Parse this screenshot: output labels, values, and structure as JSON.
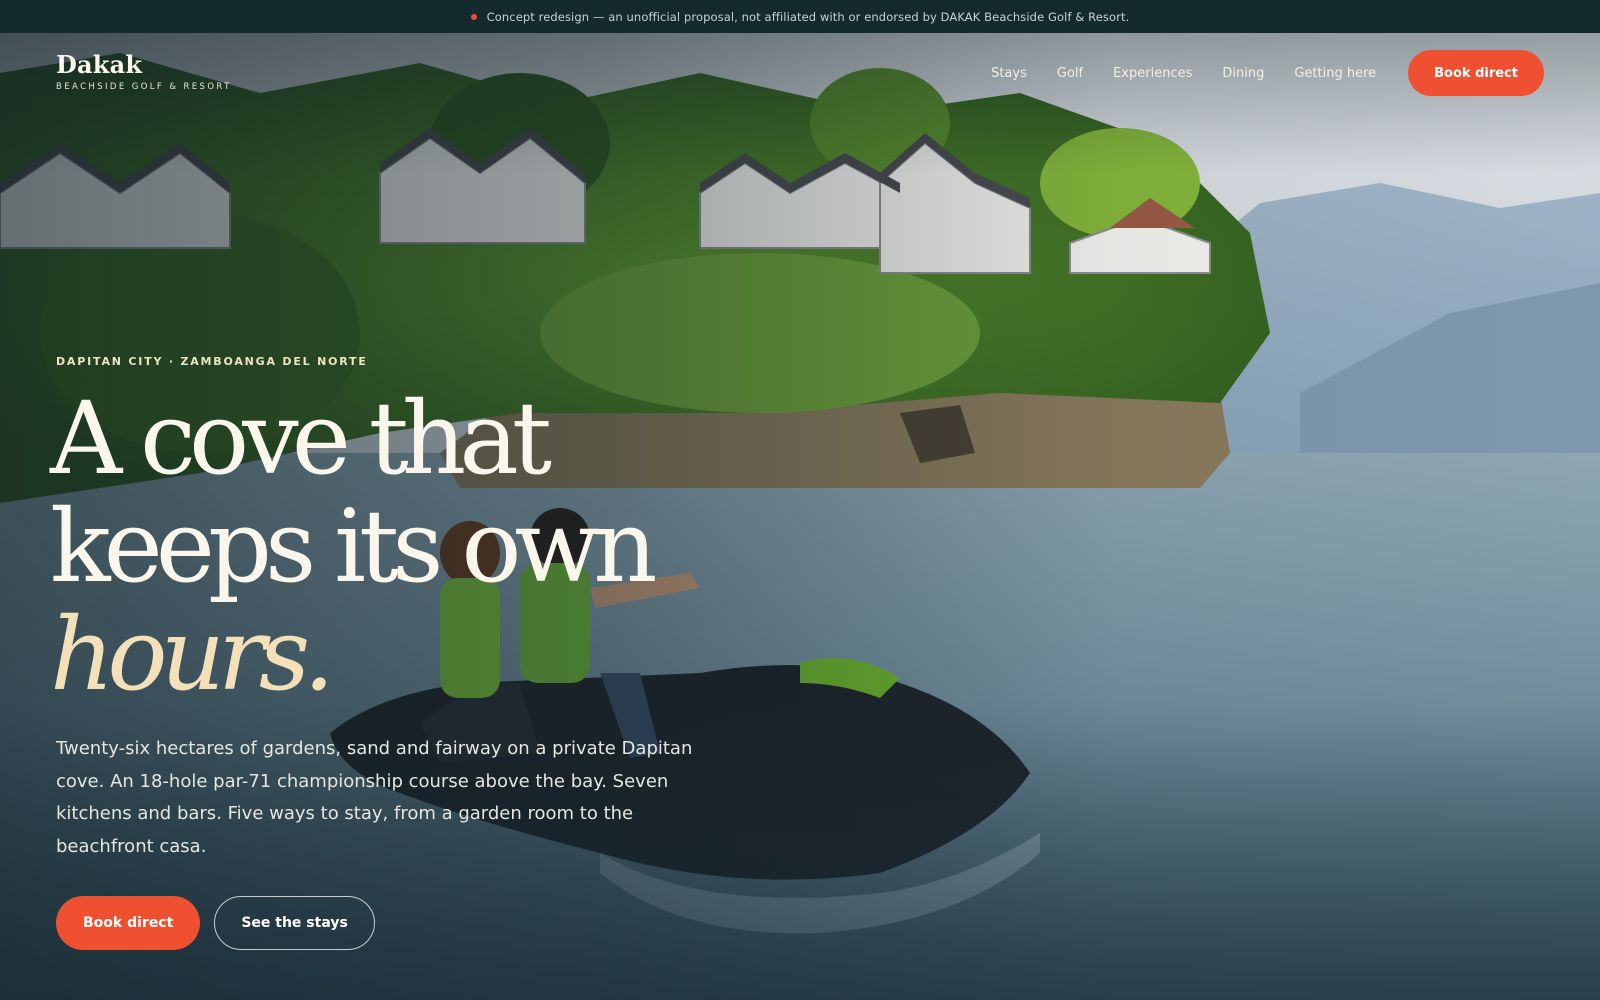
{
  "banner": {
    "text": "Concept redesign — an unofficial proposal, not affiliated with or endorsed by DAKAK Beachside Golf & Resort.",
    "dot_color": "#f05032"
  },
  "brand": {
    "name": "Dakak",
    "tagline": "BEACHSIDE GOLF & RESORT"
  },
  "nav": {
    "items": [
      "Stays",
      "Golf",
      "Experiences",
      "Dining",
      "Getting here"
    ],
    "book_label": "Book direct"
  },
  "hero": {
    "eyebrow": "DAPITAN CITY · ZAMBOANGA DEL NORTE",
    "headline": {
      "line1": "A cove that",
      "line2": "keeps its own",
      "line3": "hours."
    },
    "lede": "Twenty-six hectares of gardens, sand and fairway on a private Dapitan cove. An 18-hole par-71 championship course above the bay. Seven kitchens and bars. Five ways to stay, from a garden room to the beachfront casa.",
    "primary_cta": "Book direct",
    "secondary_cta": "See the stays"
  },
  "colors": {
    "accent": "#f05032",
    "headline_accent": "#f3dfb8",
    "banner_bg": "#132a2e"
  }
}
